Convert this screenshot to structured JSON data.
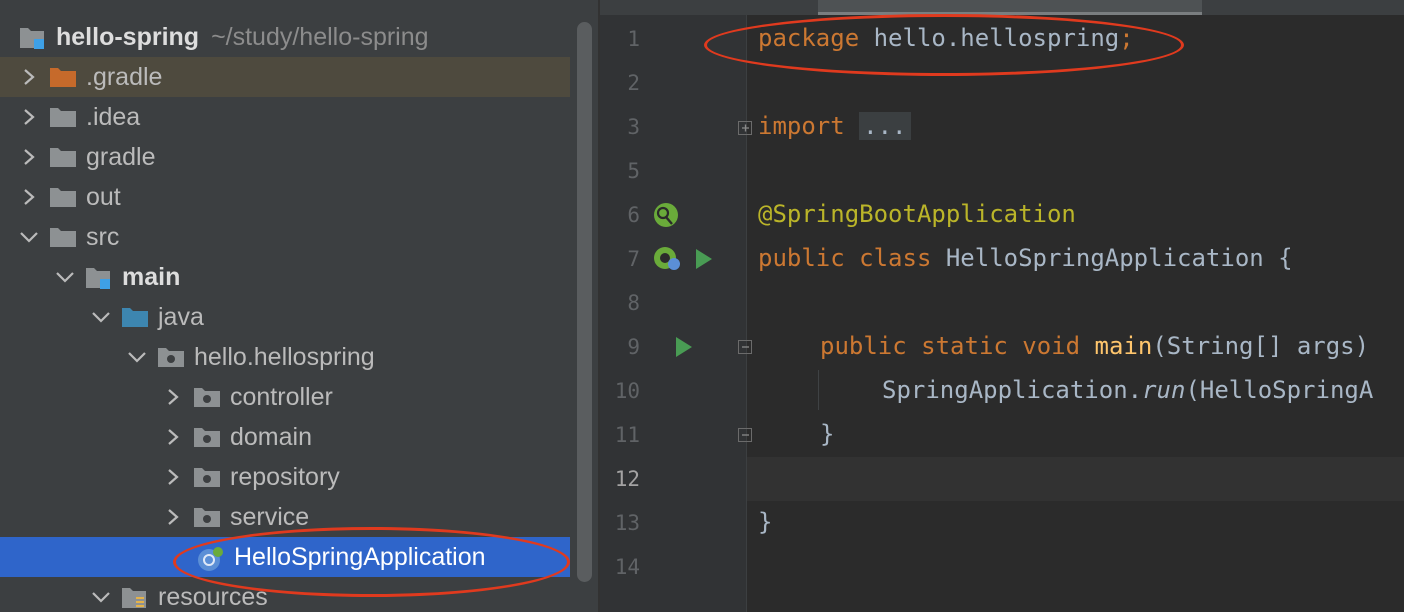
{
  "project": {
    "root_name": "hello-spring",
    "root_path": "~/study/hello-spring",
    "items": [
      {
        "label": ".gradle"
      },
      {
        "label": ".idea"
      },
      {
        "label": "gradle"
      },
      {
        "label": "out"
      },
      {
        "label": "src"
      },
      {
        "label": "main"
      },
      {
        "label": "java"
      },
      {
        "label": "hello.hellospring"
      },
      {
        "label": "controller"
      },
      {
        "label": "domain"
      },
      {
        "label": "repository"
      },
      {
        "label": "service"
      },
      {
        "label": "HelloSpringApplication"
      },
      {
        "label": "resources"
      }
    ],
    "selected_item": "HelloSpringApplication"
  },
  "editor": {
    "line_numbers": [
      "1",
      "2",
      "3",
      "5",
      "6",
      "7",
      "8",
      "9",
      "10",
      "11",
      "12",
      "13",
      "14"
    ],
    "current_line": "12",
    "code": {
      "l1_kw": "package",
      "l1_rest": " hello.hellospring",
      "l1_semi": ";",
      "l3_kw": "import",
      "l3_fold": "...",
      "l6_ann": "@SpringBootApplication",
      "l7_kw": "public class",
      "l7_rest": " HelloSpringApplication {",
      "l9_kw": "public static void",
      "l9_mth": "main",
      "l9_rest": "(String[] args)",
      "l10_a": "SpringApplication.",
      "l10_run": "run",
      "l10_b": "(HelloSpringA",
      "l11": "}",
      "l13": "}"
    }
  },
  "colors": {
    "annotation_oval": "#e03a1e",
    "selection": "#2f65ca",
    "keyword": "#cc7832",
    "annotation": "#bbb529",
    "method": "#ffc66d"
  },
  "icons": [
    "module-folder-icon",
    "folder-icon",
    "package-icon",
    "spring-boot-class-icon",
    "run-icon",
    "spring-bean-icon",
    "fold-icon",
    "resources-folder-icon"
  ]
}
